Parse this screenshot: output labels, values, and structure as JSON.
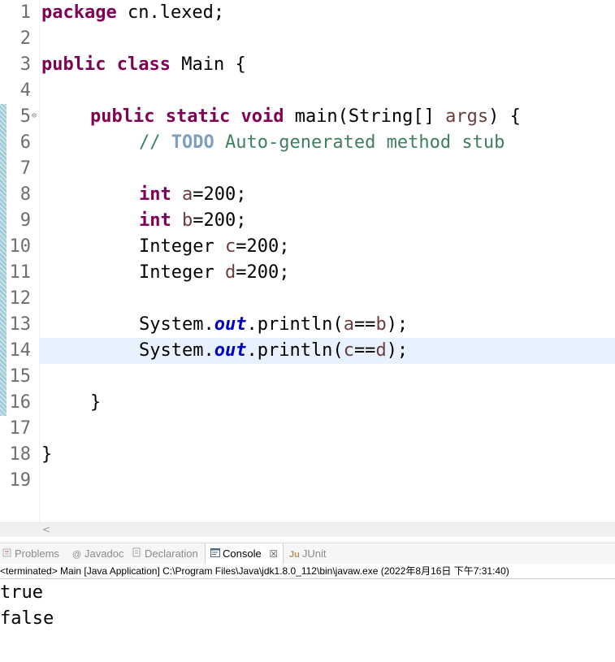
{
  "editor": {
    "line_numbers": [
      "1",
      "2",
      "3",
      "4",
      "5",
      "6",
      "7",
      "8",
      "9",
      "10",
      "11",
      "12",
      "13",
      "14",
      "15",
      "16",
      "17",
      "18",
      "19"
    ],
    "fold_marker": "⊖",
    "code": {
      "l1_kw": "package",
      "l1_rest": " cn.lexed;",
      "l3_kw1": "public",
      "l3_kw2": "class",
      "l3_rest": " Main {",
      "l5_kw1": "public",
      "l5_kw2": "static",
      "l5_kw3": "void",
      "l5_mid": " main(String[] ",
      "l5_arg": "args",
      "l5_end": ") {",
      "l6_slashes": "// ",
      "l6_todo": "TODO",
      "l6_text": " Auto-generated method stub",
      "l8_kw": "int",
      "l8_var": "a",
      "l8_rest": "=200;",
      "l9_kw": "int",
      "l9_var": "b",
      "l9_rest": "=200;",
      "l10_type": "Integer ",
      "l10_var": "c",
      "l10_rest": "=200;",
      "l11_type": "Integer ",
      "l11_var": "d",
      "l11_rest": "=200;",
      "l13_a": "System.",
      "l13_field": "out",
      "l13_b": ".println(",
      "l13_v1": "a",
      "l13_op": "==",
      "l13_v2": "b",
      "l13_end": ");",
      "l14_a": "System.",
      "l14_field": "out",
      "l14_b": ".println(",
      "l14_v1": "c",
      "l14_op": "==",
      "l14_v2": "d",
      "l14_end": ");",
      "l16": "}",
      "l18": "}"
    }
  },
  "scrollbar": {
    "left_arrow": "<"
  },
  "tabs": [
    {
      "label": "Problems",
      "icon": "problems-icon"
    },
    {
      "label": "Javadoc",
      "icon": "javadoc-icon",
      "glyph": "@"
    },
    {
      "label": "Declaration",
      "icon": "declaration-icon"
    },
    {
      "label": "Console",
      "icon": "console-icon",
      "close": "☒"
    },
    {
      "label": "JUnit",
      "icon": "junit-icon",
      "glyph": "Ju"
    }
  ],
  "console": {
    "status": "<terminated> Main [Java Application] C:\\Program Files\\Java\\jdk1.8.0_112\\bin\\javaw.exe  (2022年8月16日 下午7:31:40)",
    "output": [
      "true",
      "false"
    ]
  }
}
